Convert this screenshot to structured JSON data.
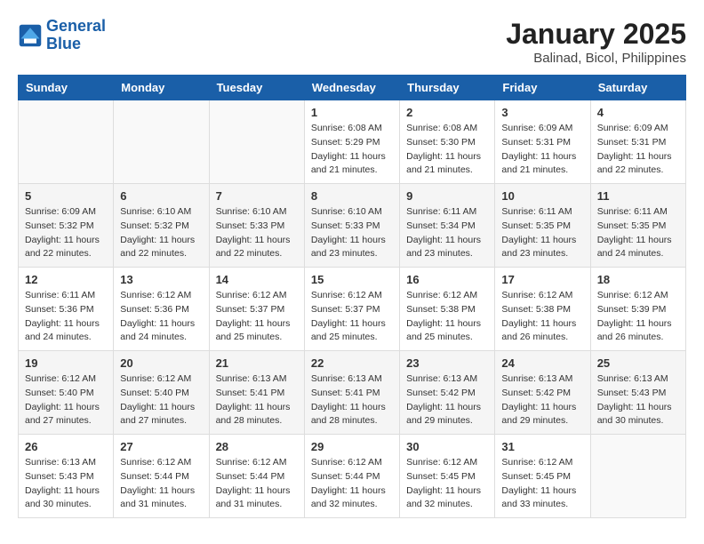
{
  "logo": {
    "text_general": "General",
    "text_blue": "Blue"
  },
  "title": "January 2025",
  "subtitle": "Balinad, Bicol, Philippines",
  "weekdays": [
    "Sunday",
    "Monday",
    "Tuesday",
    "Wednesday",
    "Thursday",
    "Friday",
    "Saturday"
  ],
  "weeks": [
    [
      {
        "day": "",
        "info": ""
      },
      {
        "day": "",
        "info": ""
      },
      {
        "day": "",
        "info": ""
      },
      {
        "day": "1",
        "info": "Sunrise: 6:08 AM\nSunset: 5:29 PM\nDaylight: 11 hours\nand 21 minutes."
      },
      {
        "day": "2",
        "info": "Sunrise: 6:08 AM\nSunset: 5:30 PM\nDaylight: 11 hours\nand 21 minutes."
      },
      {
        "day": "3",
        "info": "Sunrise: 6:09 AM\nSunset: 5:31 PM\nDaylight: 11 hours\nand 21 minutes."
      },
      {
        "day": "4",
        "info": "Sunrise: 6:09 AM\nSunset: 5:31 PM\nDaylight: 11 hours\nand 22 minutes."
      }
    ],
    [
      {
        "day": "5",
        "info": "Sunrise: 6:09 AM\nSunset: 5:32 PM\nDaylight: 11 hours\nand 22 minutes."
      },
      {
        "day": "6",
        "info": "Sunrise: 6:10 AM\nSunset: 5:32 PM\nDaylight: 11 hours\nand 22 minutes."
      },
      {
        "day": "7",
        "info": "Sunrise: 6:10 AM\nSunset: 5:33 PM\nDaylight: 11 hours\nand 22 minutes."
      },
      {
        "day": "8",
        "info": "Sunrise: 6:10 AM\nSunset: 5:33 PM\nDaylight: 11 hours\nand 23 minutes."
      },
      {
        "day": "9",
        "info": "Sunrise: 6:11 AM\nSunset: 5:34 PM\nDaylight: 11 hours\nand 23 minutes."
      },
      {
        "day": "10",
        "info": "Sunrise: 6:11 AM\nSunset: 5:35 PM\nDaylight: 11 hours\nand 23 minutes."
      },
      {
        "day": "11",
        "info": "Sunrise: 6:11 AM\nSunset: 5:35 PM\nDaylight: 11 hours\nand 24 minutes."
      }
    ],
    [
      {
        "day": "12",
        "info": "Sunrise: 6:11 AM\nSunset: 5:36 PM\nDaylight: 11 hours\nand 24 minutes."
      },
      {
        "day": "13",
        "info": "Sunrise: 6:12 AM\nSunset: 5:36 PM\nDaylight: 11 hours\nand 24 minutes."
      },
      {
        "day": "14",
        "info": "Sunrise: 6:12 AM\nSunset: 5:37 PM\nDaylight: 11 hours\nand 25 minutes."
      },
      {
        "day": "15",
        "info": "Sunrise: 6:12 AM\nSunset: 5:37 PM\nDaylight: 11 hours\nand 25 minutes."
      },
      {
        "day": "16",
        "info": "Sunrise: 6:12 AM\nSunset: 5:38 PM\nDaylight: 11 hours\nand 25 minutes."
      },
      {
        "day": "17",
        "info": "Sunrise: 6:12 AM\nSunset: 5:38 PM\nDaylight: 11 hours\nand 26 minutes."
      },
      {
        "day": "18",
        "info": "Sunrise: 6:12 AM\nSunset: 5:39 PM\nDaylight: 11 hours\nand 26 minutes."
      }
    ],
    [
      {
        "day": "19",
        "info": "Sunrise: 6:12 AM\nSunset: 5:40 PM\nDaylight: 11 hours\nand 27 minutes."
      },
      {
        "day": "20",
        "info": "Sunrise: 6:12 AM\nSunset: 5:40 PM\nDaylight: 11 hours\nand 27 minutes."
      },
      {
        "day": "21",
        "info": "Sunrise: 6:13 AM\nSunset: 5:41 PM\nDaylight: 11 hours\nand 28 minutes."
      },
      {
        "day": "22",
        "info": "Sunrise: 6:13 AM\nSunset: 5:41 PM\nDaylight: 11 hours\nand 28 minutes."
      },
      {
        "day": "23",
        "info": "Sunrise: 6:13 AM\nSunset: 5:42 PM\nDaylight: 11 hours\nand 29 minutes."
      },
      {
        "day": "24",
        "info": "Sunrise: 6:13 AM\nSunset: 5:42 PM\nDaylight: 11 hours\nand 29 minutes."
      },
      {
        "day": "25",
        "info": "Sunrise: 6:13 AM\nSunset: 5:43 PM\nDaylight: 11 hours\nand 30 minutes."
      }
    ],
    [
      {
        "day": "26",
        "info": "Sunrise: 6:13 AM\nSunset: 5:43 PM\nDaylight: 11 hours\nand 30 minutes."
      },
      {
        "day": "27",
        "info": "Sunrise: 6:12 AM\nSunset: 5:44 PM\nDaylight: 11 hours\nand 31 minutes."
      },
      {
        "day": "28",
        "info": "Sunrise: 6:12 AM\nSunset: 5:44 PM\nDaylight: 11 hours\nand 31 minutes."
      },
      {
        "day": "29",
        "info": "Sunrise: 6:12 AM\nSunset: 5:44 PM\nDaylight: 11 hours\nand 32 minutes."
      },
      {
        "day": "30",
        "info": "Sunrise: 6:12 AM\nSunset: 5:45 PM\nDaylight: 11 hours\nand 32 minutes."
      },
      {
        "day": "31",
        "info": "Sunrise: 6:12 AM\nSunset: 5:45 PM\nDaylight: 11 hours\nand 33 minutes."
      },
      {
        "day": "",
        "info": ""
      }
    ]
  ]
}
